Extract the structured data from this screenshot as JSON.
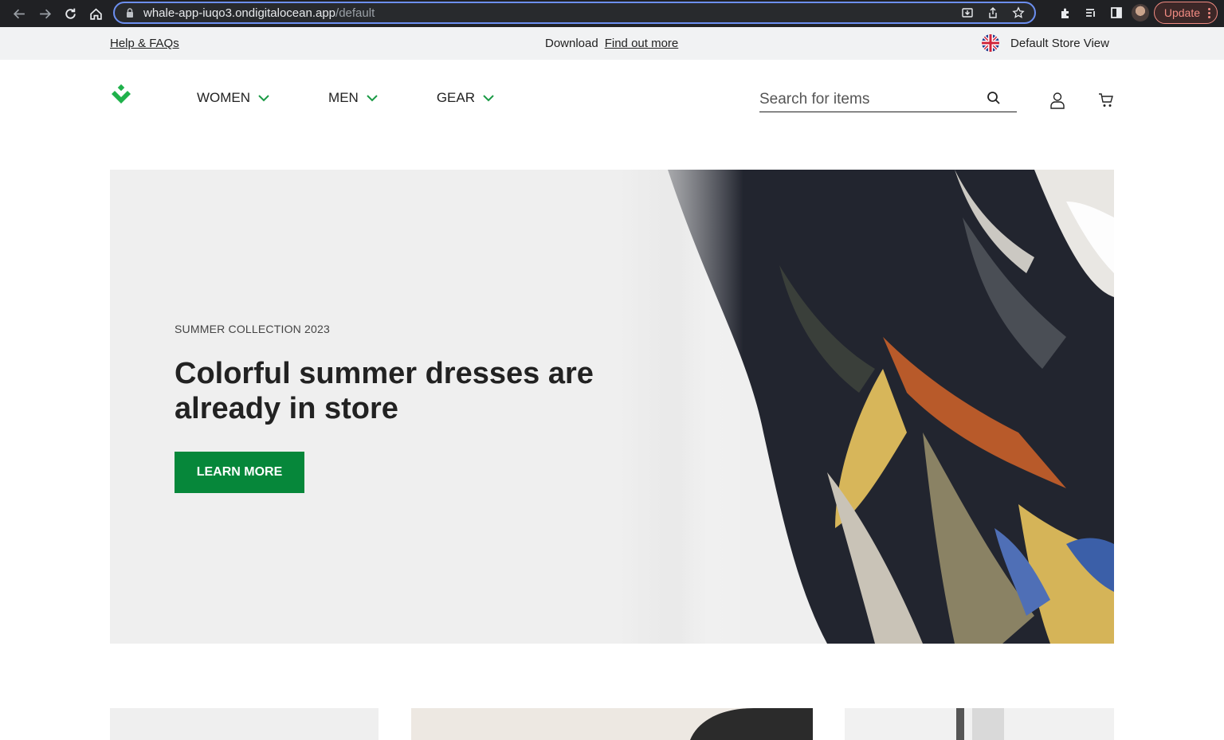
{
  "browser": {
    "url_host": "whale-app-iuqo3.ondigitalocean.app",
    "url_path": "/default",
    "update_label": "Update",
    "icons": [
      "back-icon",
      "forward-icon",
      "reload-icon",
      "home-icon",
      "lock-icon",
      "install-icon",
      "share-icon",
      "star-icon",
      "extensions-icon",
      "reading-list-icon",
      "side-panel-icon",
      "profile-avatar",
      "more-icon"
    ]
  },
  "topbar": {
    "help_label": "Help & FAQs",
    "download_label": "Download",
    "find_out_more_label": "Find out more",
    "store_view_label": "Default Store View",
    "flag_icon": "uk-flag-icon"
  },
  "header": {
    "logo_icon": "brand-logo-icon",
    "menu": [
      {
        "label": "WOMEN"
      },
      {
        "label": "MEN"
      },
      {
        "label": "GEAR"
      }
    ],
    "search_placeholder": "Search for items",
    "accent_color": "#06873a"
  },
  "hero": {
    "eyebrow": "SUMMER COLLECTION 2023",
    "headline": "Colorful summer dresses are already in store",
    "cta_label": "LEARN MORE",
    "background_color": "#efefef"
  }
}
